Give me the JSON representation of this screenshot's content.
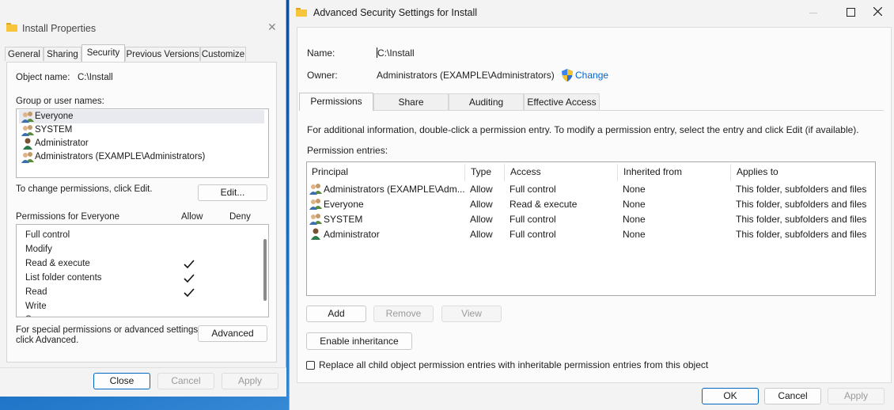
{
  "props_window": {
    "title": "Install Properties",
    "close_glyph": "✕",
    "tabs": [
      "General",
      "Sharing",
      "Security",
      "Previous Versions",
      "Customize"
    ],
    "object_name_label": "Object name:",
    "object_name_value": "C:\\Install",
    "group_label": "Group or user names:",
    "users": [
      {
        "name": "Everyone",
        "icon": "users-icon"
      },
      {
        "name": "SYSTEM",
        "icon": "users-icon"
      },
      {
        "name": "Administrator",
        "icon": "user-icon"
      },
      {
        "name": "Administrators (EXAMPLE\\Administrators)",
        "icon": "users-icon"
      }
    ],
    "change_hint": "To change permissions, click Edit.",
    "edit_button": "Edit...",
    "perm_header": "Permissions for Everyone",
    "allow_header": "Allow",
    "deny_header": "Deny",
    "permissions": [
      {
        "name": "Full control",
        "allow": false,
        "deny": false
      },
      {
        "name": "Modify",
        "allow": false,
        "deny": false
      },
      {
        "name": "Read & execute",
        "allow": true,
        "deny": false
      },
      {
        "name": "List folder contents",
        "allow": true,
        "deny": false
      },
      {
        "name": "Read",
        "allow": true,
        "deny": false
      },
      {
        "name": "Write",
        "allow": false,
        "deny": false
      }
    ],
    "special_hint_line1": "For special permissions or advanced settings,",
    "special_hint_line2": "click Advanced.",
    "advanced_button": "Advanced",
    "footer": {
      "close": "Close",
      "cancel": "Cancel",
      "apply": "Apply"
    }
  },
  "adv_window": {
    "title": "Advanced Security Settings for Install",
    "controls": {
      "minimize": "—",
      "maximize": "☐",
      "close": "✕"
    },
    "name_label": "Name:",
    "name_value": "C:\\Install",
    "owner_label": "Owner:",
    "owner_value": "Administrators (EXAMPLE\\Administrators)",
    "change_link": "Change",
    "tabs": [
      "Permissions",
      "Share",
      "Auditing",
      "Effective Access"
    ],
    "info_text": "For additional information, double-click a permission entry. To modify a permission entry, select the entry and click Edit (if available).",
    "entries_label": "Permission entries:",
    "columns": [
      "Principal",
      "Type",
      "Access",
      "Inherited from",
      "Applies to"
    ],
    "entries": [
      {
        "principal": "Administrators (EXAMPLE\\Adm...",
        "icon": "users-icon",
        "type": "Allow",
        "access": "Full control",
        "inherited": "None",
        "applies": "This folder, subfolders and files"
      },
      {
        "principal": "Everyone",
        "icon": "users-icon",
        "type": "Allow",
        "access": "Read & execute",
        "inherited": "None",
        "applies": "This folder, subfolders and files"
      },
      {
        "principal": "SYSTEM",
        "icon": "users-icon",
        "type": "Allow",
        "access": "Full control",
        "inherited": "None",
        "applies": "This folder, subfolders and files"
      },
      {
        "principal": "Administrator",
        "icon": "user-icon",
        "type": "Allow",
        "access": "Full control",
        "inherited": "None",
        "applies": "This folder, subfolders and files"
      }
    ],
    "buttons": {
      "add": "Add",
      "remove": "Remove",
      "view": "View",
      "enable_inheritance": "Enable inheritance"
    },
    "replace_checkbox_label": "Replace all child object permission entries with inheritable permission entries from this object",
    "replace_checked": false,
    "footer": {
      "ok": "OK",
      "cancel": "Cancel",
      "apply": "Apply"
    }
  },
  "colors": {
    "link": "#0066cc",
    "accent": "#0067c0",
    "folder": "#f7c53a"
  }
}
